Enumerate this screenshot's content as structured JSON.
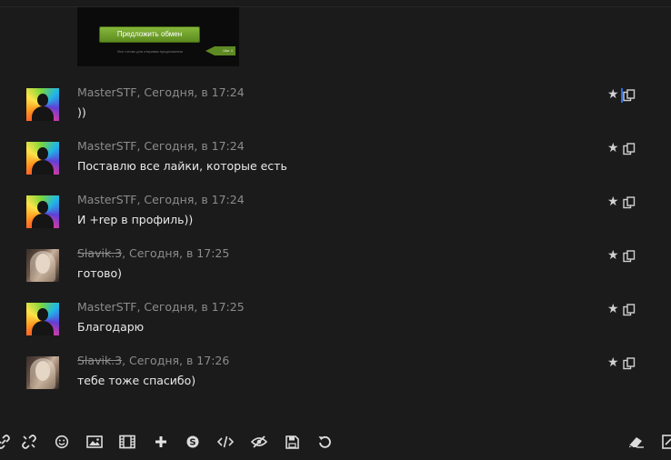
{
  "embed": {
    "button_label": "Предложить обмен",
    "hint": "Все готово для отправки предложения",
    "tag": "Шаг 4"
  },
  "messages": [
    {
      "author": "MasterSTF",
      "time": ", Сегодня, в 17:24",
      "text": "))",
      "avatar": "default",
      "banned": false
    },
    {
      "author": "MasterSTF",
      "time": ", Сегодня, в 17:24",
      "text": "Поставлю все лайки, которые есть",
      "avatar": "default",
      "banned": false
    },
    {
      "author": "MasterSTF",
      "time": ", Сегодня, в 17:24",
      "text": "И +rep в профиль))",
      "avatar": "default",
      "banned": false
    },
    {
      "author": "Slavik.3",
      "time": ", Сегодня, в 17:25",
      "text": "готово)",
      "avatar": "photo",
      "banned": true
    },
    {
      "author": "MasterSTF",
      "time": ", Сегодня, в 17:25",
      "text": "Благодарю",
      "avatar": "default",
      "banned": false
    },
    {
      "author": "Slavik.3",
      "time": ", Сегодня, в 17:26",
      "text": "тебе тоже спасибо)",
      "avatar": "photo",
      "banned": true
    }
  ],
  "toolbar": {
    "icons": [
      "link-icon",
      "unlink-icon",
      "smiley-icon",
      "image-icon",
      "video-icon",
      "plus-icon",
      "skype-icon",
      "code-icon",
      "hide-icon",
      "save-icon",
      "undo-icon",
      "eraser-icon",
      "edit-icon"
    ]
  },
  "colors": {
    "background": "#1b1b1b",
    "text": "#e9e9e9",
    "meta": "#8c8c8c",
    "accent_green": "#6fa12b"
  }
}
